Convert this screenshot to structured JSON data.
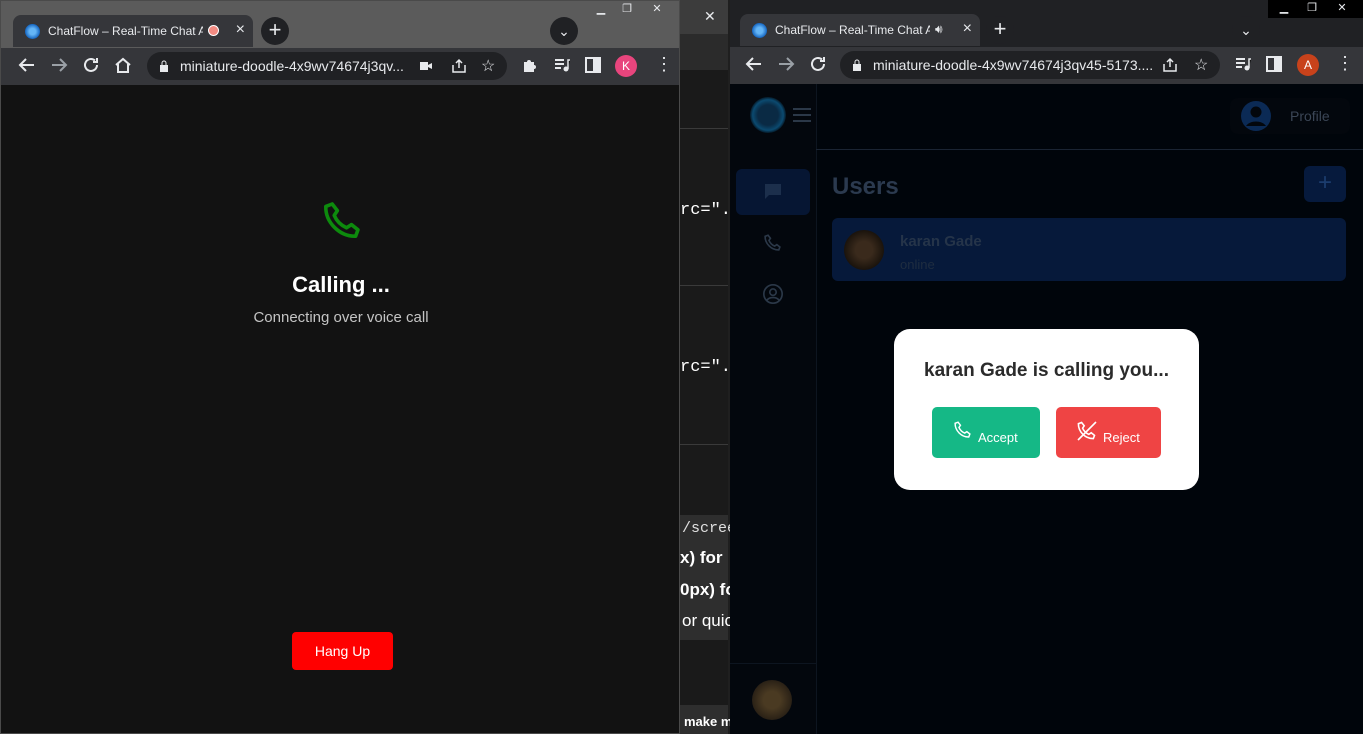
{
  "left_window": {
    "tab": {
      "title": "ChatFlow – Real-Time Chat A"
    },
    "new_tab": "+",
    "url": "miniature-doodle-4x9wv74674j3qv...",
    "avatar_letter": "K",
    "call": {
      "title": "Calling ...",
      "subtitle": "Connecting over voice call",
      "hangup_label": "Hang Up"
    }
  },
  "middle_window": {
    "close": "✕",
    "code_lines": [
      "rc=\"./",
      "rc=\"./",
      "/scree",
      "x) for",
      "0px) fo",
      "or quic",
      "make m"
    ]
  },
  "right_window": {
    "tab": {
      "title": "ChatFlow – Real-Time Chat A"
    },
    "new_tab": "+",
    "url": "miniature-doodle-4x9wv74674j3qv45-5173....",
    "avatar_letter": "A",
    "app": {
      "profile_label": "Profile",
      "users_title": "Users",
      "add_label": "+",
      "users": [
        {
          "name": "karan Gade",
          "status": "online"
        }
      ],
      "incoming": {
        "title": "karan Gade is calling you...",
        "accept_label": "Accept",
        "reject_label": "Reject"
      }
    }
  },
  "colors": {
    "accent_green": "#15b886",
    "reject_red": "#ef4444",
    "hangup_red": "#ff0000",
    "call_icon_green": "#0d8a0d"
  }
}
